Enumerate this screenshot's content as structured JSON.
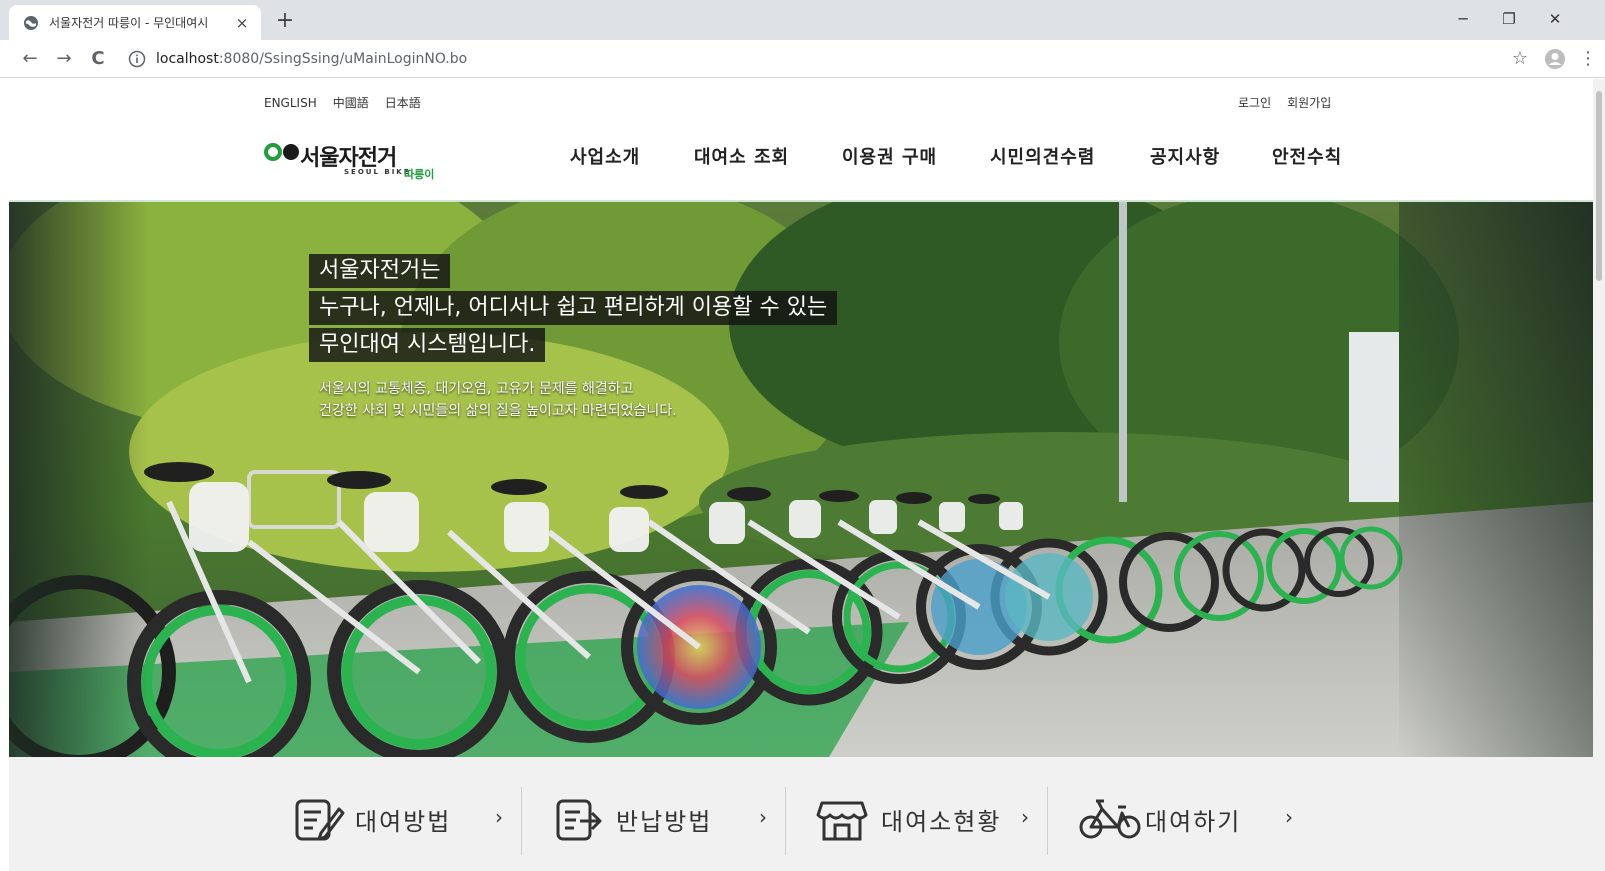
{
  "browser": {
    "tab_title": "서울자전거 따릉이 - 무인대여시",
    "tab_close": "×",
    "new_tab": "+",
    "url_host": "localhost",
    "url_path": ":8080/SsingSsing/uMainLoginNO.bo",
    "window_controls": {
      "minimize": "─",
      "restore": "❐",
      "close": "✕"
    },
    "nav": {
      "back": "←",
      "forward": "→",
      "reload": "C"
    },
    "toolbar_right": {
      "bookmark": "☆",
      "menu": "⋮"
    }
  },
  "util_nav": {
    "languages": [
      "ENGLISH",
      "中國語",
      "日本語"
    ],
    "account": [
      "로그인",
      "회원가입"
    ]
  },
  "logo": {
    "text": "서울자전거",
    "sub": "SEOUL BIKE",
    "brand": "따릉이"
  },
  "gnb": [
    "사업소개",
    "대여소 조회",
    "이용권 구매",
    "시민의견수렴",
    "공지사항",
    "안전수칙"
  ],
  "hero": {
    "lines": [
      "서울자전거는",
      "누구나, 언제나, 어디서나 쉽고 편리하게 이용할 수 있는",
      "무인대여 시스템입니다."
    ],
    "sub": [
      "서울시의 교통체증, 대기오염, 고유가 문제를 해결하고",
      "건강한 사회 및 시민들의 삶의 질을 높이고자 마련되었습니다."
    ]
  },
  "quick_menu": [
    {
      "label": "대여방법",
      "icon": "rental-guide-icon",
      "arrow": "›"
    },
    {
      "label": "반납방법",
      "icon": "return-guide-icon",
      "arrow": "›"
    },
    {
      "label": "대여소현황",
      "icon": "station-icon",
      "arrow": "›"
    },
    {
      "label": "대여하기",
      "icon": "bicycle-icon",
      "arrow": "›"
    }
  ],
  "colors": {
    "brand_green": "#1e9e3c",
    "header_line": "#cfe6d7",
    "quick_bg": "#f1f1f1"
  }
}
